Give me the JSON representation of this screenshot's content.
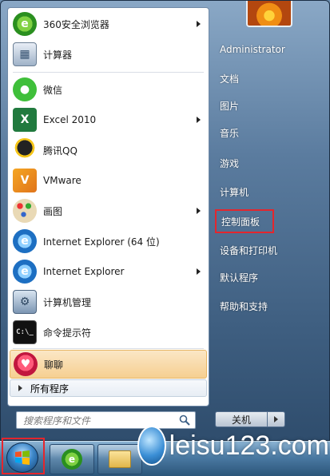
{
  "start_menu": {
    "programs": [
      {
        "label": "360安全浏览器",
        "icon": "360-browser-icon",
        "has_arrow": true
      },
      {
        "label": "计算器",
        "icon": "calculator-icon",
        "has_arrow": false
      },
      {
        "label": "微信",
        "icon": "wechat-icon",
        "has_arrow": false
      },
      {
        "label": "Excel 2010",
        "icon": "excel-icon",
        "has_arrow": true
      },
      {
        "label": "腾讯QQ",
        "icon": "qq-penguin-icon",
        "has_arrow": false
      },
      {
        "label": "VMware",
        "icon": "vmware-icon",
        "has_arrow": false
      },
      {
        "label": "画图",
        "icon": "paint-palette-icon",
        "has_arrow": true
      },
      {
        "label": "Internet Explorer (64 位)",
        "icon": "ie-icon",
        "has_arrow": false
      },
      {
        "label": "Internet Explorer",
        "icon": "ie-icon",
        "has_arrow": true
      },
      {
        "label": "计算机管理",
        "icon": "computer-management-icon",
        "has_arrow": false
      },
      {
        "label": "命令提示符",
        "icon": "command-prompt-icon",
        "has_arrow": false
      },
      {
        "label": "聊聊",
        "icon": "heart-chat-icon",
        "has_arrow": false,
        "highlighted": true
      }
    ],
    "all_programs_label": "所有程序",
    "search_placeholder": "搜索程序和文件",
    "right_items": [
      {
        "label": "Administrator"
      },
      {
        "label": "文档"
      },
      {
        "label": "图片"
      },
      {
        "label": "音乐"
      },
      {
        "label": "游戏"
      },
      {
        "label": "计算机"
      },
      {
        "label": "控制面板",
        "boxed": true
      },
      {
        "label": "设备和打印机"
      },
      {
        "label": "默认程序"
      },
      {
        "label": "帮助和支持"
      }
    ],
    "shutdown_label": "关机"
  },
  "watermark": {
    "text": "leisu123.com"
  },
  "colors": {
    "highlight_box": "#e4262d"
  }
}
